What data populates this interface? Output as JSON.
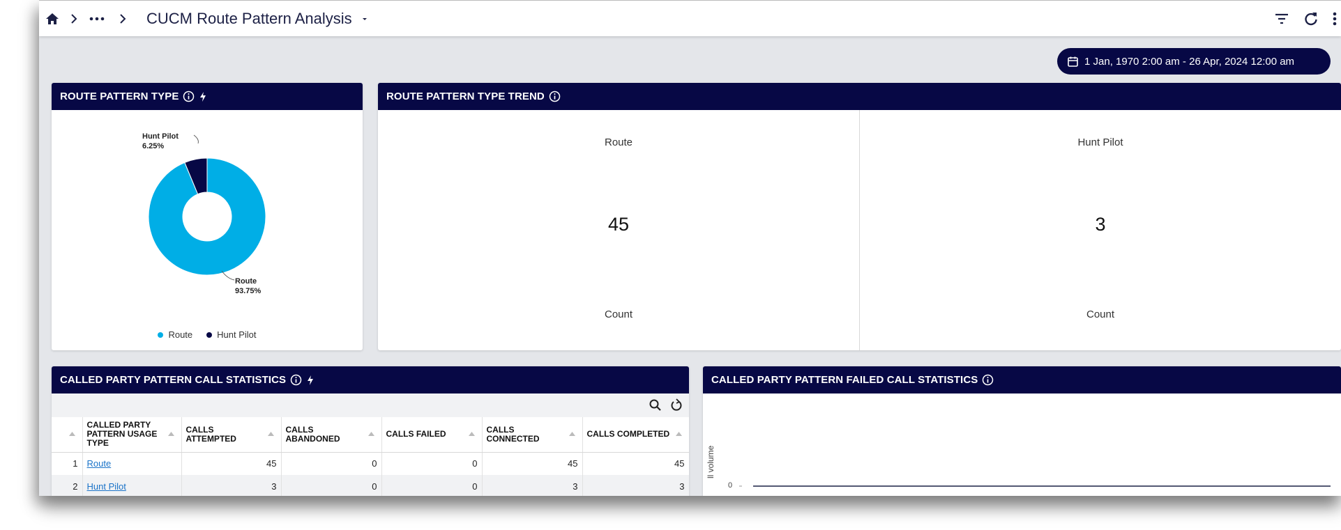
{
  "app": {
    "title": "CUCM Route Pattern Analysis",
    "breadcrumb_more": "..."
  },
  "date_range": {
    "label": "1 Jan, 1970 2:00 am - 26 Apr, 2024 12:00 am"
  },
  "panels": {
    "route_pattern_type": {
      "title": "ROUTE PATTERN TYPE",
      "legend": [
        {
          "label": "Route",
          "color": "#00aee6"
        },
        {
          "label": "Hunt Pilot",
          "color": "#070845"
        }
      ]
    },
    "route_pattern_type_trend": {
      "title": "ROUTE PATTERN TYPE TREND",
      "cards": [
        {
          "label": "Route",
          "value": "45",
          "unit": "Count"
        },
        {
          "label": "Hunt Pilot",
          "value": "3",
          "unit": "Count"
        }
      ]
    },
    "called_party_stats": {
      "title": "CALLED PARTY PATTERN CALL STATISTICS",
      "columns": [
        "CALLED PARTY PATTERN USAGE TYPE",
        "CALLS ATTEMPTED",
        "CALLS ABANDONED",
        "CALLS FAILED",
        "CALLS CONNECTED",
        "CALLS COMPLETED"
      ],
      "rows": [
        {
          "index": "1",
          "type": "Route",
          "attempted": "45",
          "abandoned": "0",
          "failed": "0",
          "connected": "45",
          "completed": "45"
        },
        {
          "index": "2",
          "type": "Hunt Pilot",
          "attempted": "3",
          "abandoned": "0",
          "failed": "0",
          "connected": "3",
          "completed": "3"
        }
      ]
    },
    "called_party_failed": {
      "title": "CALLED PARTY PATTERN FAILED CALL STATISTICS",
      "ylabel": "ll volume",
      "ytick": "0"
    }
  },
  "chart_data": {
    "type": "pie",
    "title": "ROUTE PATTERN TYPE",
    "slices": [
      {
        "label": "Route",
        "value": 93.75,
        "display": "93.75%",
        "color": "#00aee6"
      },
      {
        "label": "Hunt Pilot",
        "value": 6.25,
        "display": "6.25%",
        "color": "#070845"
      }
    ],
    "legend": "bottom-center",
    "donut": true
  }
}
